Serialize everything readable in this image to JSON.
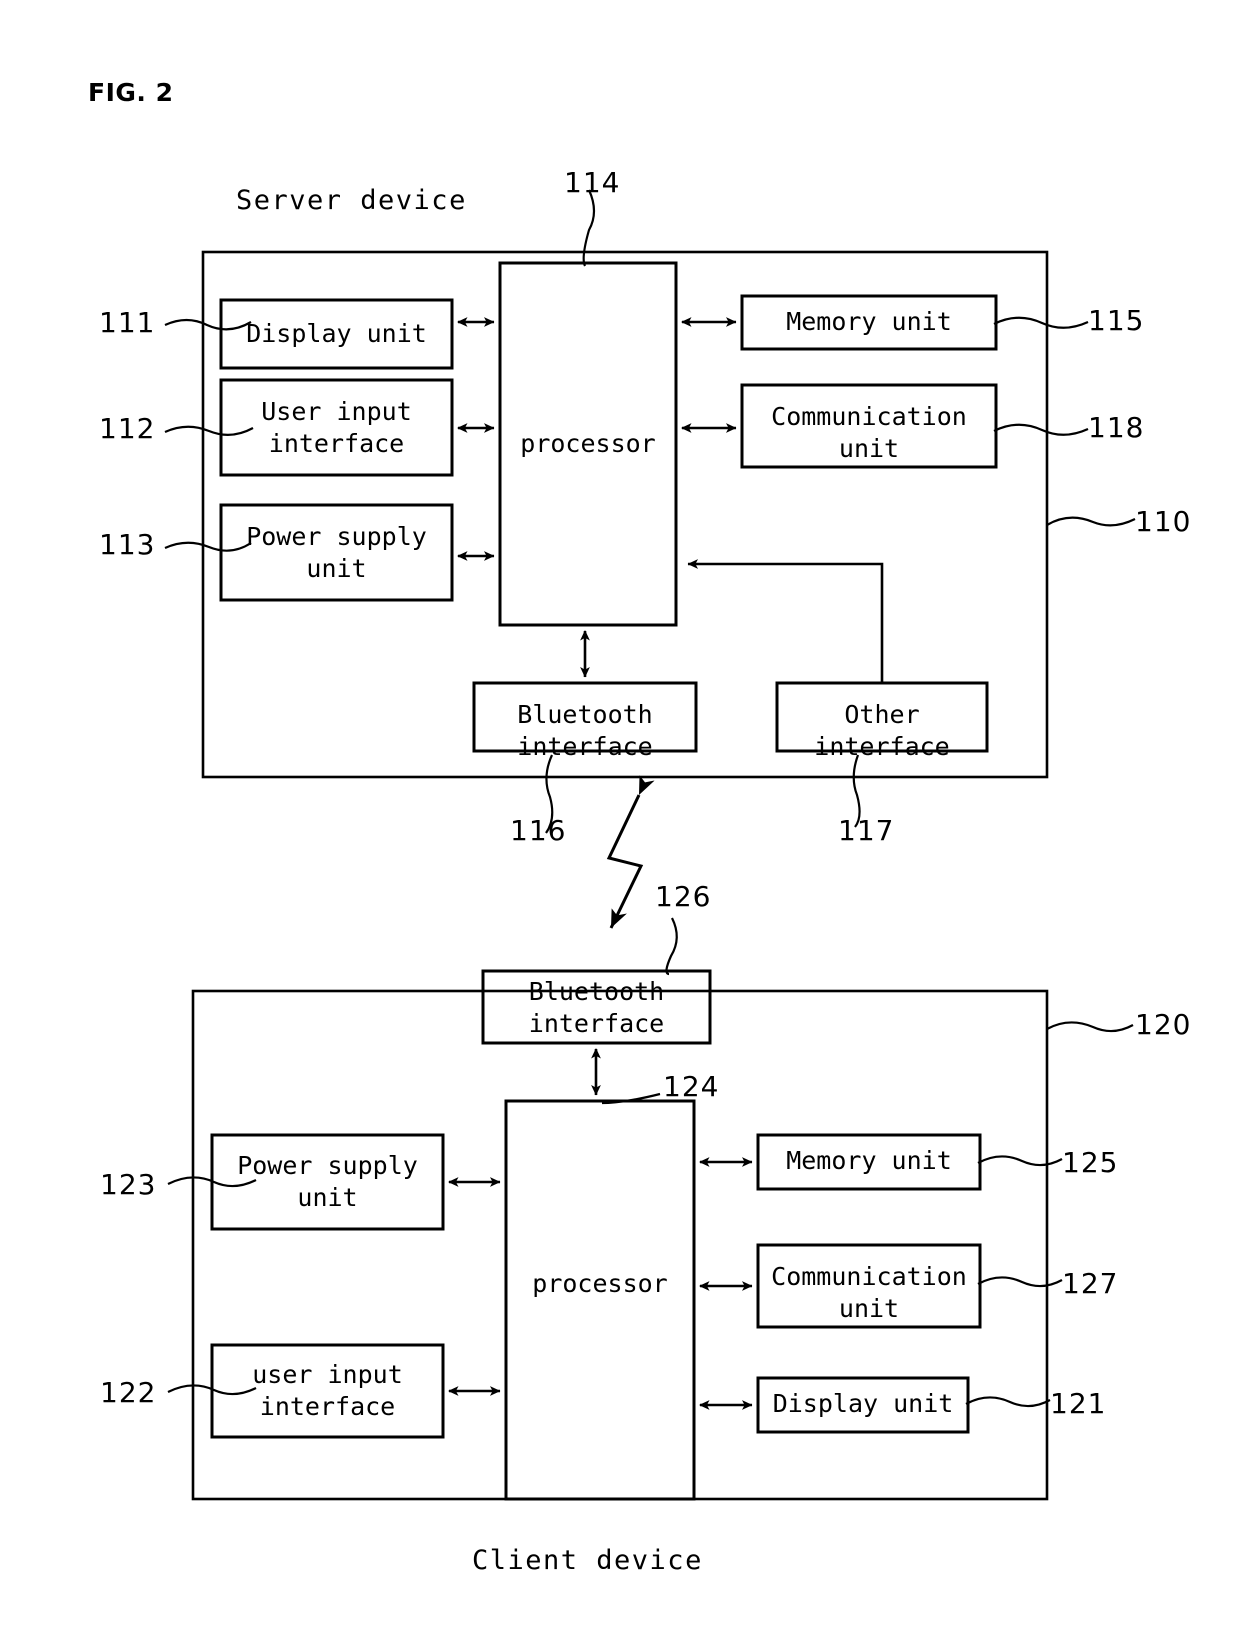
{
  "figure": {
    "number_label": "FIG. 2",
    "server_caption": "Server device",
    "client_caption": "Client device"
  },
  "server": {
    "ref": "110",
    "processor": {
      "label": "processor",
      "ref": "114"
    },
    "left_blocks": [
      {
        "label": "Display unit",
        "ref": "111",
        "lines": [
          "Display unit"
        ]
      },
      {
        "label": "User input interface",
        "ref": "112",
        "lines": [
          "User input",
          "interface"
        ]
      },
      {
        "label": "Power supply unit",
        "ref": "113",
        "lines": [
          "Power supply",
          "unit"
        ]
      }
    ],
    "right_blocks": [
      {
        "label": "Memory unit",
        "ref": "115",
        "lines": [
          "Memory unit"
        ]
      },
      {
        "label": "Communication unit",
        "ref": "118",
        "lines": [
          "Communication",
          "unit"
        ]
      }
    ],
    "bottom_blocks": [
      {
        "label": "Bluetooth interface",
        "ref": "116",
        "lines": [
          "Bluetooth",
          "interface"
        ]
      },
      {
        "label": "Other interface",
        "ref": "117",
        "lines": [
          "Other",
          "interface"
        ]
      }
    ]
  },
  "client": {
    "ref": "120",
    "processor": {
      "label": "processor",
      "ref": "124"
    },
    "top_blocks": [
      {
        "label": "Bluetooth interface",
        "ref": "126",
        "lines": [
          "Bluetooth",
          "interface"
        ]
      }
    ],
    "left_blocks": [
      {
        "label": "Power supply unit",
        "ref": "123",
        "lines": [
          "Power supply",
          "unit"
        ]
      },
      {
        "label": "user input interface",
        "ref": "122",
        "lines": [
          "user input",
          "interface"
        ]
      }
    ],
    "right_blocks": [
      {
        "label": "Memory unit",
        "ref": "125",
        "lines": [
          "Memory unit"
        ]
      },
      {
        "label": "Communication unit",
        "ref": "127",
        "lines": [
          "Communication",
          "unit"
        ]
      },
      {
        "label": "Display unit",
        "ref": "121",
        "lines": [
          "Display unit"
        ]
      }
    ]
  },
  "link": {
    "name": "wireless-bluetooth-link",
    "style": "lightning-double-arrow"
  },
  "colors": {
    "ink": "#000000",
    "paper": "#ffffff"
  }
}
